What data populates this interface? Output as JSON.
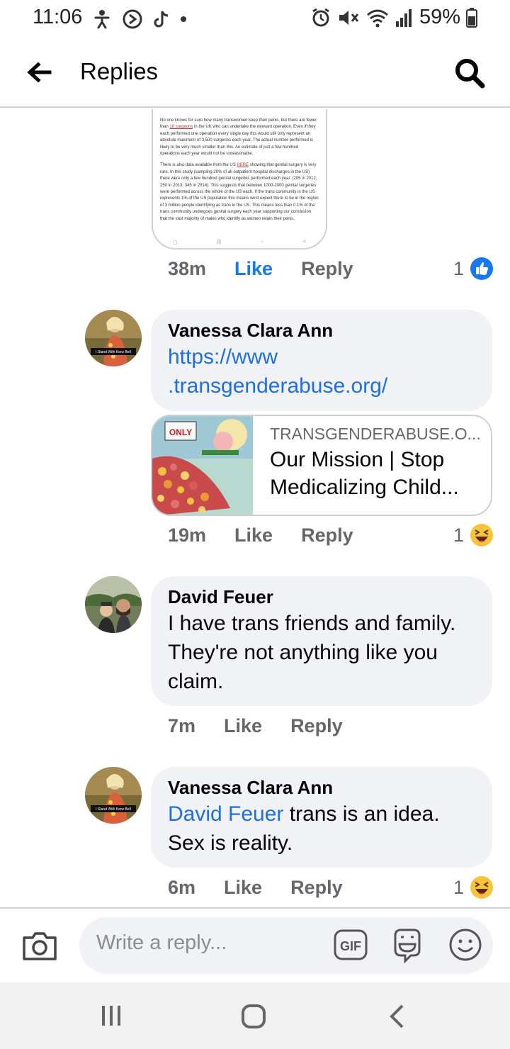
{
  "status_bar": {
    "time": "11:06",
    "battery": "59%",
    "left_icons": [
      "accessibility-icon",
      "assistant-icon",
      "tiktok-icon",
      "dot-icon"
    ],
    "right_icons": [
      "alarm-icon",
      "mute-icon",
      "wifi-icon",
      "signal-icon",
      "battery-icon"
    ]
  },
  "header": {
    "title": "Replies"
  },
  "screenshot_image": {
    "paragraph1": {
      "before": "No one knows for sure how many transwomen keep their penis, but there are fewer than ",
      "link": "10 surgeons",
      "after": " in the UK who can undertake the relevant operation. Even if they each performed one operation every single day this would still only represent an absolute maximum of 3,500 surgeries each year. The actual number performed is likely to be very much smaller than this. An estimate of just a few hundred operations each year would not be unreasonable."
    },
    "paragraph2": {
      "before": "There is also data available from the US ",
      "link": "HERE",
      "after": " showing that genital surgery is very rare. In this study (sampling 20% of all outpatient hospital discharges in the US) there were only a few hundred genital surgeries performed each year. (205 in 2012, 250 in 2013, 345 in 2014). This suggests that between 1000-2000 genital surgeries were performed across the whole of the US each. If the trans community in the US represents 1% of the US population this means we'd expect there to be in the region of 3 million people identifying as trans in the US. This means less than 0.1% of the trans community undergoes genital surgery each year supporting our conclusion that the vast majority of males who identify as women retain their penis."
    }
  },
  "comments": [
    {
      "time": "38m",
      "like_label": "Like",
      "reply_label": "Reply",
      "reaction_count": "1",
      "reaction_type": "like-reaction-icon",
      "liked": true
    },
    {
      "author": "Vanessa Clara Ann",
      "avatar_caption": "I Stand With Kenz Bell",
      "text_lines": [
        "https://www",
        ".transgenderabuse.org/"
      ],
      "link_preview": {
        "domain": "TRANSGENDERABUSE.O...",
        "title_line1": "Our Mission | Stop",
        "title_line2": "Medicalizing Child...",
        "image_banner": "ONLY"
      },
      "time": "19m",
      "like_label": "Like",
      "reply_label": "Reply",
      "reaction_count": "1",
      "reaction_type": "haha-reaction-icon"
    },
    {
      "author": "David Feuer",
      "text_lines": [
        "I have trans friends and family.",
        "They're not anything like you",
        "claim."
      ],
      "time": "7m",
      "like_label": "Like",
      "reply_label": "Reply"
    },
    {
      "author": "Vanessa Clara Ann",
      "avatar_caption": "I Stand With Kenz Bell",
      "mention": "David Feuer",
      "text_line1_rest": " trans is an idea.",
      "text_line2": "Sex is reality.",
      "time": "6m",
      "like_label": "Like",
      "reply_label": "Reply",
      "reaction_count": "1",
      "reaction_type": "haha-reaction-icon"
    }
  ],
  "composer": {
    "placeholder": "Write a reply...",
    "gif_label": "GIF"
  },
  "colors": {
    "link_blue": "#216fdb",
    "like_active": "#1877f2",
    "muted": "#65676b",
    "bubble": "#f0f2f5"
  }
}
